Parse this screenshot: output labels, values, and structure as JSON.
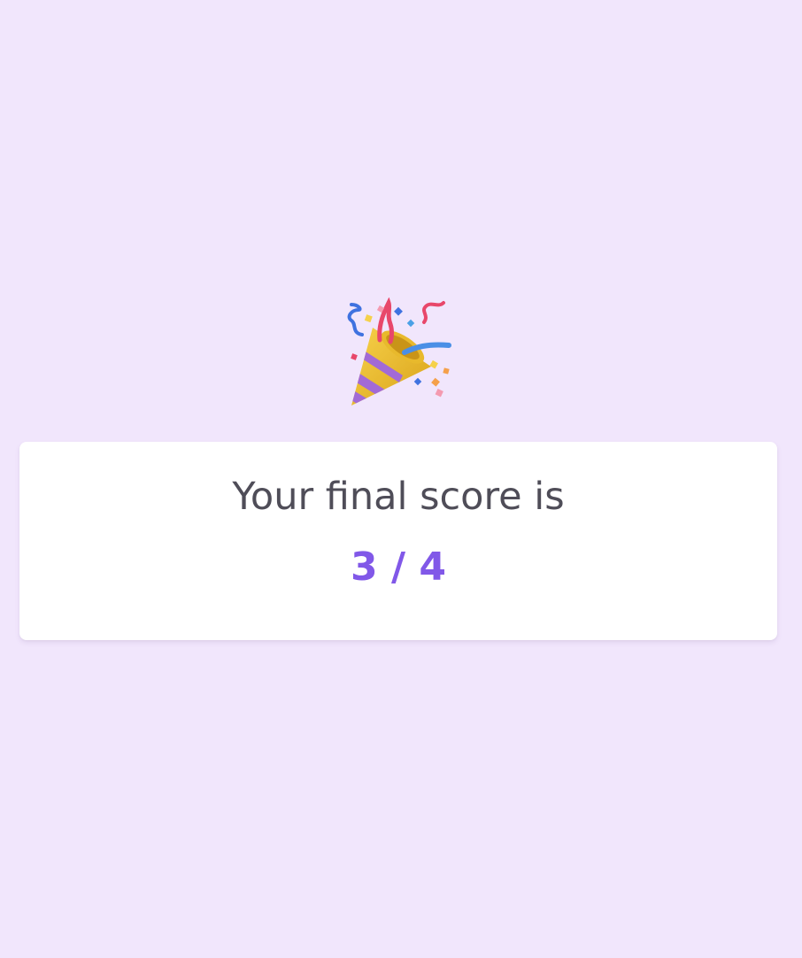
{
  "result": {
    "icon": "party-popper-icon",
    "label": "Your final score is",
    "score": "3 / 4"
  },
  "colors": {
    "background": "#f1e6fc",
    "card": "#ffffff",
    "label_text": "#4f4d58",
    "score_text": "#8158e8"
  }
}
